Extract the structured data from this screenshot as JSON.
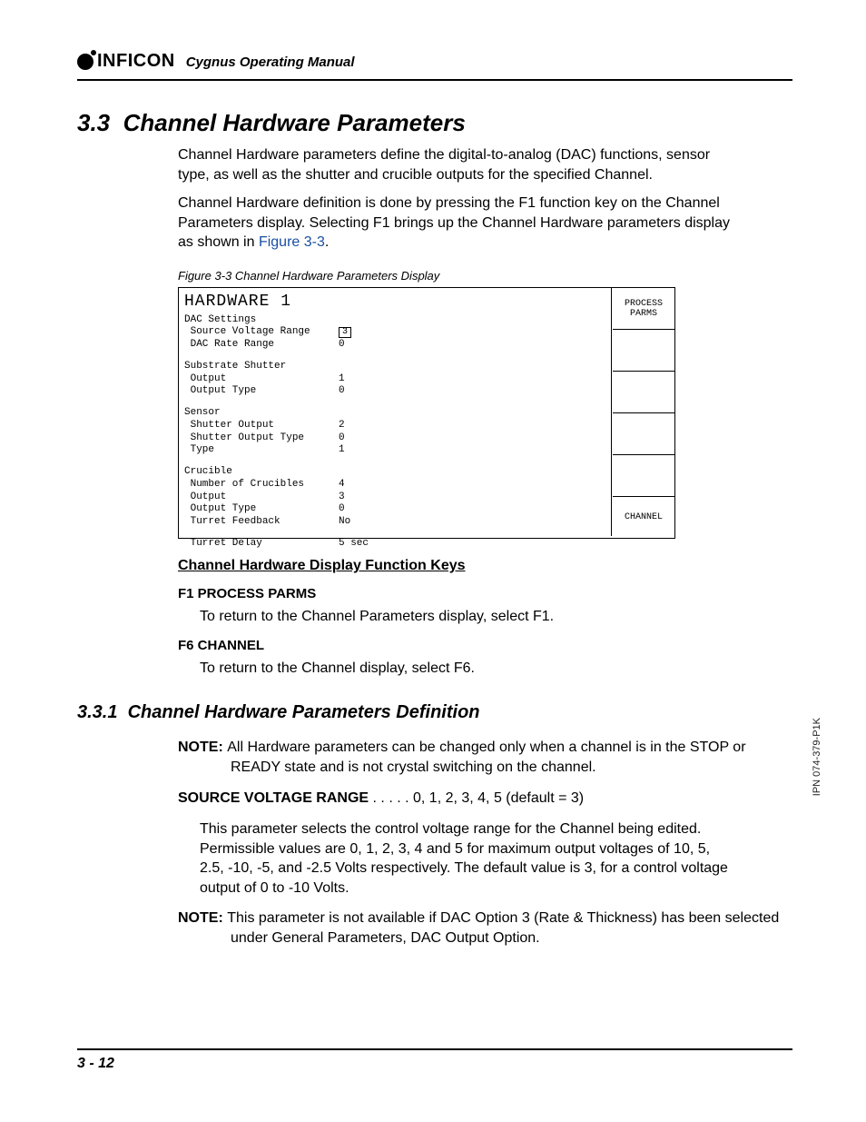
{
  "header": {
    "brand": "INFICON",
    "manual": "Cygnus Operating Manual"
  },
  "section": {
    "num": "3.3",
    "title": "Channel Hardware Parameters",
    "para1": "Channel Hardware parameters define the digital-to-analog (DAC) functions, sensor type, as well as the shutter and crucible outputs for the specified Channel.",
    "para2a": "Channel Hardware definition is done by pressing the F1 function key on the Channel Parameters display. Selecting F1 brings up the Channel Hardware parameters display as shown in ",
    "figref": "Figure 3-3",
    "para2b": "."
  },
  "figcap": "Figure 3-3  Channel Hardware Parameters Display",
  "hw": {
    "title": "HARDWARE 1",
    "groups": [
      {
        "hdr": "DAC Settings",
        "rows": [
          {
            "l": " Source Voltage Range",
            "v": "3",
            "boxed": true
          },
          {
            "l": " DAC Rate Range",
            "v": "0"
          }
        ]
      },
      {
        "hdr": "Substrate Shutter",
        "rows": [
          {
            "l": " Output",
            "v": "1"
          },
          {
            "l": " Output Type",
            "v": "0"
          }
        ]
      },
      {
        "hdr": "Sensor",
        "rows": [
          {
            "l": " Shutter Output",
            "v": "2"
          },
          {
            "l": " Shutter Output Type",
            "v": "0"
          },
          {
            "l": " Type",
            "v": "1"
          }
        ]
      },
      {
        "hdr": "Crucible",
        "rows": [
          {
            "l": " Number of Crucibles",
            "v": "4"
          },
          {
            "l": " Output",
            "v": "3"
          },
          {
            "l": " Output Type",
            "v": "0"
          },
          {
            "l": " Turret Feedback",
            "v": "No"
          }
        ]
      },
      {
        "hdr": "",
        "rows": [
          {
            "l": " Turret Delay",
            "v": "5 sec"
          }
        ]
      }
    ],
    "side": [
      "PROCESS\nPARMS",
      "",
      "",
      "",
      "",
      "CHANNEL"
    ]
  },
  "fkeys": {
    "hdr": "Channel Hardware Display Function Keys",
    "f1": {
      "t": "F1 PROCESS PARMS",
      "b": "To return to the Channel Parameters display, select F1."
    },
    "f6": {
      "t": "F6 CHANNEL",
      "b": "To return to the Channel display, select F6."
    }
  },
  "sub": {
    "num": "3.3.1",
    "title": "Channel Hardware Parameters Definition",
    "note1lbl": "NOTE:",
    "note1": "All Hardware parameters can be changed only when a channel is in the STOP or READY state and is not crystal switching on the channel.",
    "param_name": "SOURCE VOLTAGE RANGE",
    "param_dots": " . . . . . ",
    "param_vals": "0, 1, 2, 3, 4, 5 (default = 3)",
    "param_body": "This parameter selects the control voltage range for the Channel being edited. Permissible values are 0, 1, 2, 3, 4 and 5 for maximum output voltages of 10, 5, 2.5, -10, -5, and -2.5 Volts respectively. The default value is 3, for a control voltage output of 0 to -10 Volts.",
    "note2lbl": "NOTE:",
    "note2": "This parameter is not available if DAC Option 3 (Rate & Thickness) has been selected under General Parameters, DAC Output Option."
  },
  "sidecode": "IPN 074-379-P1K",
  "pagenum": "3 - 12"
}
